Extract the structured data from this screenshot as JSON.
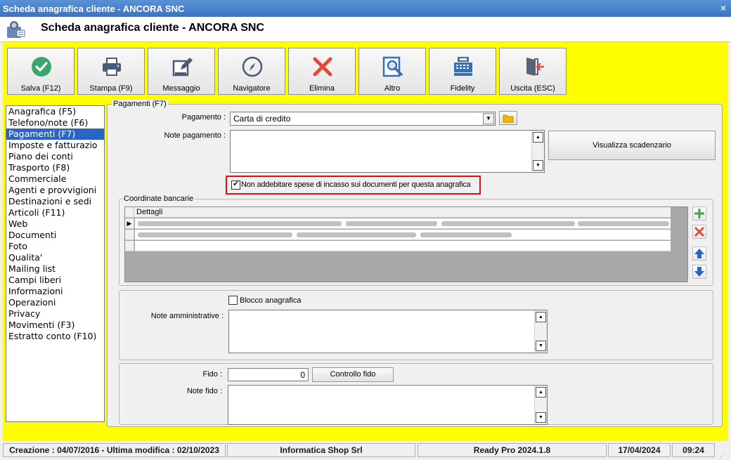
{
  "window": {
    "title": "Scheda anagrafica cliente - ANCORA SNC",
    "header_title": "Scheda anagrafica cliente - ANCORA SNC",
    "close_glyph": "✕"
  },
  "toolbar": {
    "buttons": [
      {
        "label": "Salva (F12)",
        "icon": "check-icon",
        "color": "#3aa76d"
      },
      {
        "label": "Stampa (F9)",
        "icon": "printer-icon",
        "color": "#4a5b78"
      },
      {
        "label": "Messaggio",
        "icon": "edit-document-icon",
        "color": "#4a5b78"
      },
      {
        "label": "Navigatore",
        "icon": "compass-icon",
        "color": "#4a5b78"
      },
      {
        "label": "Elimina",
        "icon": "delete-x-icon",
        "color": "#e04a3a"
      },
      {
        "label": "Altro",
        "icon": "search-document-icon",
        "color": "#3a6fb6"
      },
      {
        "label": "Fidelity",
        "icon": "cash-register-icon",
        "color": "#3a6fb6"
      },
      {
        "label": "Uscita (ESC)",
        "icon": "exit-icon",
        "color": "#e04a3a"
      }
    ]
  },
  "sidebar": {
    "items": [
      {
        "label": "Anagrafica (F5)"
      },
      {
        "label": "Telefono/note (F6)"
      },
      {
        "label": "Pagamenti (F7)",
        "selected": true
      },
      {
        "label": "Imposte e fatturazio"
      },
      {
        "label": "Piano dei conti"
      },
      {
        "label": "Trasporto (F8)"
      },
      {
        "label": "Commerciale"
      },
      {
        "label": "Agenti e provvigioni"
      },
      {
        "label": "Destinazioni e sedi"
      },
      {
        "label": "Articoli (F11)"
      },
      {
        "label": "Web"
      },
      {
        "label": "Documenti"
      },
      {
        "label": "Foto"
      },
      {
        "label": "Qualita'"
      },
      {
        "label": "Mailing list"
      },
      {
        "label": "Campi liberi"
      },
      {
        "label": "Informazioni"
      },
      {
        "label": "Operazioni"
      },
      {
        "label": "Privacy"
      },
      {
        "label": "Movimenti (F3)"
      },
      {
        "label": "Estratto conto (F10)"
      }
    ]
  },
  "pagamenti": {
    "group_title": "Pagamenti (F7)",
    "pagamento_label": "Pagamento :",
    "pagamento_value": "Carta di credito",
    "note_pagamento_label": "Note pagamento :",
    "visualizza_button": "Visualizza scadenzario",
    "no_spese_label": "Non addebitare spese di incasso sui documenti per questa anagrafica",
    "no_spese_checked": true,
    "highlight_color": "#e01010"
  },
  "coordinate": {
    "group_title": "Coordinate bancarie",
    "column_header": "Dettagli"
  },
  "amministrativo": {
    "blocco_label": "Blocco anagrafica",
    "blocco_checked": false,
    "note_amm_label": "Note amministrative :"
  },
  "fido": {
    "fido_label": "Fido :",
    "fido_value": "0",
    "controllo_button": "Controllo fido",
    "note_fido_label": "Note fido :"
  },
  "status": {
    "dates": "Creazione : 04/07/2016 - Ultima modifica : 02/10/2023",
    "company": "Informatica Shop Srl",
    "product": "Ready Pro 2024.1.8",
    "date": "17/04/2024",
    "time": "09:24"
  },
  "colors": {
    "accent_yellow": "#ffff00",
    "selection_blue": "#2a64c5",
    "titlebar_blue": "#4a82cf"
  }
}
